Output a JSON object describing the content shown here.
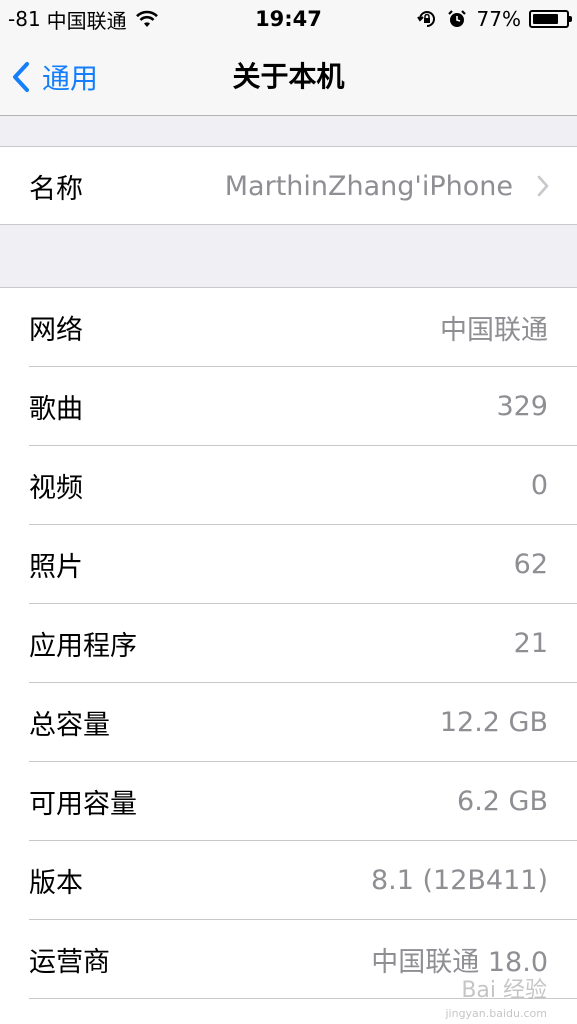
{
  "status_bar": {
    "signal": "-81",
    "carrier": "中国联通",
    "time": "19:47",
    "battery_percent": "77%",
    "battery_level": 0.77,
    "icons": [
      "wifi-icon",
      "rotation-lock-icon",
      "alarm-icon",
      "battery-icon"
    ]
  },
  "nav": {
    "back_label": "通用",
    "title": "关于本机",
    "accent_color": "#157efb"
  },
  "name_row": {
    "label": "名称",
    "value": "MarthinZhang'iPhone"
  },
  "info_rows": [
    {
      "label": "网络",
      "value": "中国联通"
    },
    {
      "label": "歌曲",
      "value": "329"
    },
    {
      "label": "视频",
      "value": "0"
    },
    {
      "label": "照片",
      "value": "62"
    },
    {
      "label": "应用程序",
      "value": "21"
    },
    {
      "label": "总容量",
      "value": "12.2 GB"
    },
    {
      "label": "可用容量",
      "value": "6.2 GB"
    },
    {
      "label": "版本",
      "value": "8.1 (12B411)"
    },
    {
      "label": "运营商",
      "value": "中国联通 18.0"
    }
  ],
  "watermark": {
    "text": "Bai 经验",
    "sub": "jingyan.baidu.com"
  }
}
